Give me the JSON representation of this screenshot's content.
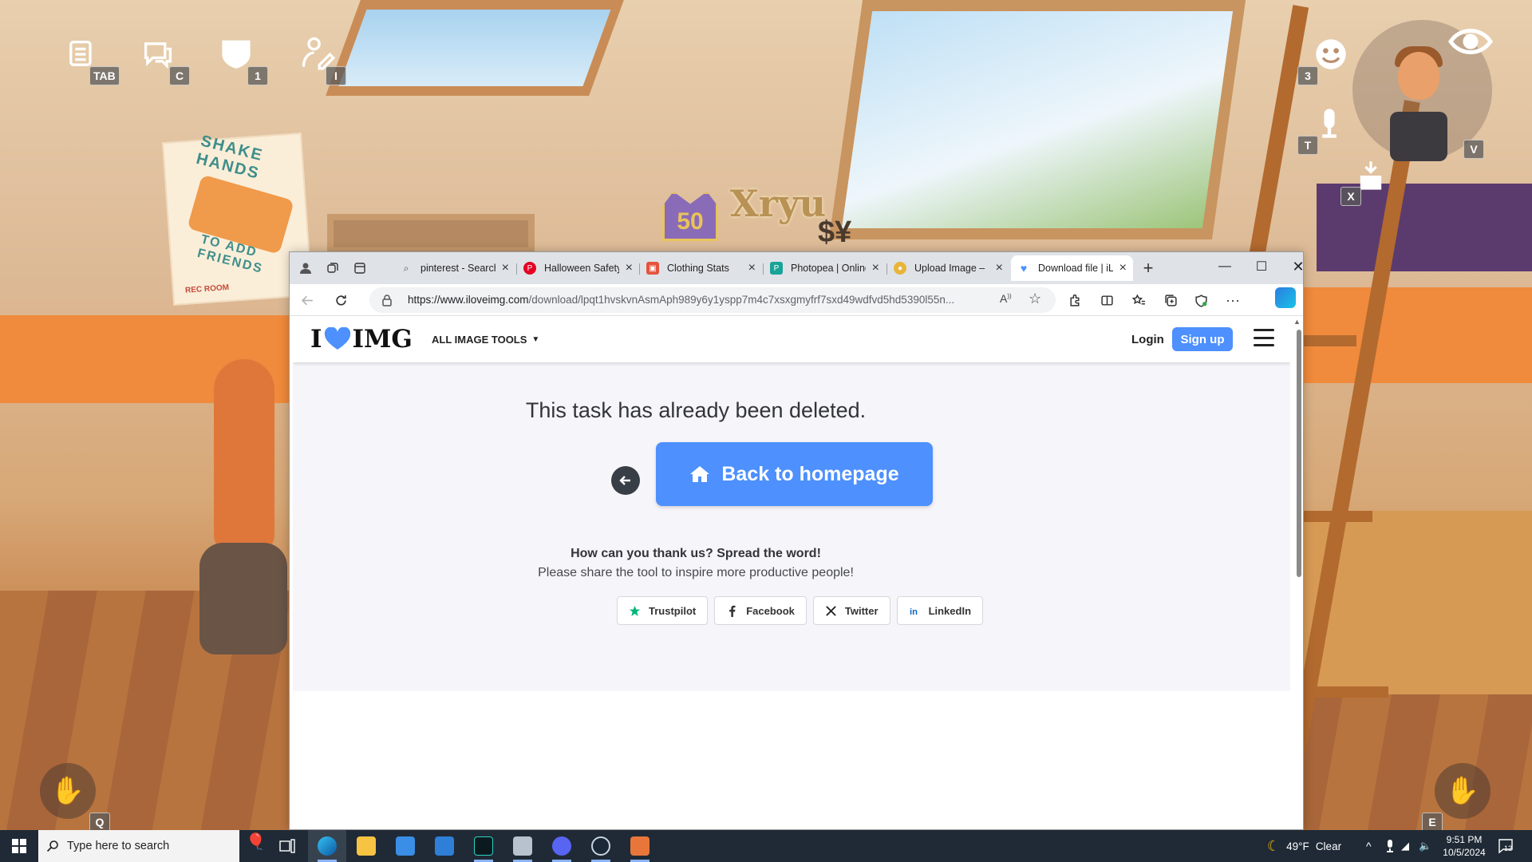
{
  "game": {
    "hud_keys": {
      "menu": "TAB",
      "chat": "C",
      "shield": "1",
      "edit": "I",
      "emote": "3",
      "mic": "T",
      "avatar": "V",
      "drop": "X",
      "wave_left": "Q",
      "wave_right": "E"
    },
    "player_level": "50",
    "player_name": "Xryu",
    "currency_symbol": "$¥",
    "poster_line1": "SHAKE HANDS",
    "poster_line2": "TO ADD FRIENDS",
    "poster_brand": "REC ROOM"
  },
  "browser": {
    "tabs": [
      {
        "title": "pinterest - Search",
        "color": "#4a6fa5"
      },
      {
        "title": "Halloween Safety",
        "color": "#e60023"
      },
      {
        "title": "Clothing Stats",
        "color": "#e5533d"
      },
      {
        "title": "Photopea | Online",
        "color": "#18a497"
      },
      {
        "title": "Upload Image – ",
        "color": "#e8b53a"
      },
      {
        "title": "Download file | iL",
        "color": "#4d90fe"
      }
    ],
    "url_domain": "https://www.iloveimg.com",
    "url_rest": "/download/lpqt1hvskvnAsmAph989y6y1yspp7m4c7xsxgmyfrf7sxd49wdfvd5hd5390l55n..."
  },
  "site": {
    "logo_left": "I",
    "logo_right": "IMG",
    "all_tools": "ALL IMAGE TOOLS",
    "login": "Login",
    "signup": "Sign up",
    "main_message": "This task has already been deleted.",
    "back_home": "Back to homepage",
    "thanks_title": "How can you thank us? Spread the word!",
    "share_text": "Please share the tool to inspire more productive people!",
    "share_buttons": [
      "Trustpilot",
      "Facebook",
      "Twitter",
      "LinkedIn"
    ]
  },
  "taskbar": {
    "search_placeholder": "Type here to search",
    "weather_temp": "49°F",
    "weather_desc": "Clear",
    "time": "9:51 PM",
    "date": "10/5/2024",
    "notifications": "12"
  },
  "colors": {
    "brand_blue": "#4d90fe",
    "trustpilot_green": "#00b67a",
    "facebook_blue": "#1877f2",
    "linkedin_blue": "#0a66c2"
  }
}
